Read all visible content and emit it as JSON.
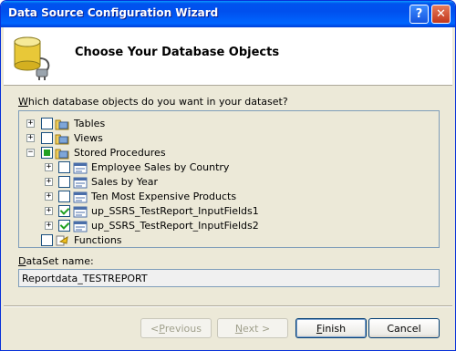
{
  "window": {
    "title": "Data Source Configuration Wizard",
    "help_label": "?",
    "close_label": "✕"
  },
  "header": {
    "title": "Choose Your Database Objects",
    "icon": "database-plug-icon"
  },
  "prompt": {
    "label": "Which database objects do you want in your dataset?"
  },
  "tree": {
    "items": [
      {
        "label": "Tables",
        "level": 0,
        "expander": "+",
        "checked": "none",
        "icon": "folder-table-icon"
      },
      {
        "label": "Views",
        "level": 0,
        "expander": "+",
        "checked": "none",
        "icon": "folder-view-icon"
      },
      {
        "label": "Stored Procedures",
        "level": 0,
        "expander": "−",
        "checked": "partial",
        "icon": "folder-procedure-icon"
      },
      {
        "label": "Employee Sales by Country",
        "level": 1,
        "expander": "+",
        "checked": "none",
        "icon": "procedure-icon"
      },
      {
        "label": "Sales by Year",
        "level": 1,
        "expander": "+",
        "checked": "none",
        "icon": "procedure-icon"
      },
      {
        "label": "Ten Most Expensive Products",
        "level": 1,
        "expander": "+",
        "checked": "none",
        "icon": "procedure-icon"
      },
      {
        "label": "up_SSRS_TestReport_InputFields1",
        "level": 1,
        "expander": "+",
        "checked": "checked",
        "icon": "procedure-icon"
      },
      {
        "label": "up_SSRS_TestReport_InputFields2",
        "level": 1,
        "expander": "+",
        "checked": "checked",
        "icon": "procedure-icon"
      },
      {
        "label": "Functions",
        "level": 0,
        "expander": "",
        "checked": "none",
        "icon": "function-icon"
      }
    ]
  },
  "dataset": {
    "label": "DataSet name:",
    "value": "Reportdata_TESTREPORT"
  },
  "buttons": {
    "previous": {
      "prefix": "< ",
      "accel": "P",
      "rest": "revious"
    },
    "next": {
      "accel": "N",
      "rest": "ext >"
    },
    "finish": {
      "accel": "F",
      "rest": "inish"
    },
    "cancel": {
      "label": "Cancel"
    }
  },
  "colors": {
    "titlebar": "#0054e3",
    "accent_check": "#21a121",
    "border": "#7f9db9"
  }
}
